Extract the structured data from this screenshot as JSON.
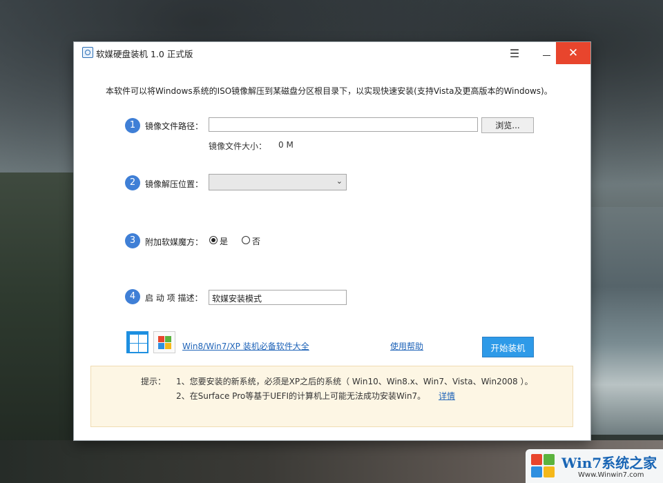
{
  "window": {
    "title": "软媒硬盘装机 1.0 正式版",
    "menu_icon": "hamburger-menu-icon",
    "minimize_icon": "minimize-icon",
    "close_icon": "close-icon",
    "close_color": "#e8452d"
  },
  "intro": "本软件可以将Windows系统的ISO镜像解压到某磁盘分区根目录下，以实现快速安装(支持Vista及更高版本的Windows)。",
  "steps": [
    {
      "num": "1",
      "label": "镜像文件路径："
    },
    {
      "num": "2",
      "label": "镜像解压位置："
    },
    {
      "num": "3",
      "label": "附加软媒魔方："
    },
    {
      "num": "4",
      "label": "启 动 项 描述："
    }
  ],
  "image_path": {
    "value": "",
    "browse_label": "浏览..."
  },
  "image_size": {
    "label": "镜像文件大小：",
    "value": "0 M"
  },
  "extract_location": {
    "selected": ""
  },
  "addon": {
    "options": [
      "是",
      "否"
    ],
    "selected": "是"
  },
  "boot_description": {
    "value": "软媒安装模式"
  },
  "footer": {
    "software_link": "Win8/Win7/XP 装机必备软件大全",
    "help_link": "使用帮助",
    "start_button": "开始装机",
    "accent_color": "#2e9ae8"
  },
  "tips": {
    "title": "提示：",
    "lines": [
      "1、您要安装的新系统，必须是XP之后的系统（ Win10、Win8.x、Win7、Vista、Win2008 ）。",
      "2、在Surface Pro等基于UEFI的计算机上可能无法成功安装Win7。"
    ],
    "details_link": "详情"
  },
  "watermark": {
    "title": "Win7系统之家",
    "url": "Www.Winwin7.com"
  }
}
